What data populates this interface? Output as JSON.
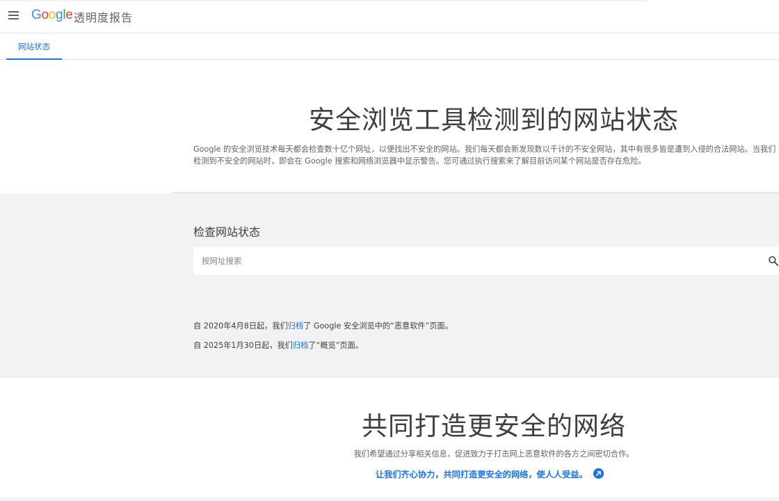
{
  "header": {
    "logo_letters": [
      {
        "char": "G",
        "color": "#4285F4"
      },
      {
        "char": "o",
        "color": "#EA4335"
      },
      {
        "char": "o",
        "color": "#FBBC05"
      },
      {
        "char": "g",
        "color": "#4285F4"
      },
      {
        "char": "l",
        "color": "#34A853"
      },
      {
        "char": "e",
        "color": "#EA4335"
      }
    ],
    "product_name": "透明度报告",
    "menu_icon": "hamburger-menu-icon"
  },
  "tabs": [
    {
      "label": "网站状态",
      "active": true
    }
  ],
  "hero": {
    "title": "安全浏览工具检测到的网站状态",
    "description": "Google 的安全浏览技术每天都会检查数十亿个网址，以便找出不安全的网站。我们每天都会新发现数以千计的不安全网站，其中有很多皆是遭到入侵的合法网站。当我们检测到不安全的网站时，即会在 Google 搜索和网络浏览器中显示警告。您可通过执行搜索来了解目前访问某个网站是否存在危险。"
  },
  "status_check": {
    "heading": "检查网站状态",
    "search_placeholder": "按网址搜索",
    "search_value": "",
    "search_icon": "search-icon"
  },
  "notices": [
    {
      "prefix": "自 2020年4月8日起，我们",
      "link_text": "归档",
      "suffix": "了 Google 安全浏览中的“恶意软件”页面。"
    },
    {
      "prefix": "自 2025年1月30日起，我们",
      "link_text": "归档",
      "suffix": "了“概览”页面。"
    }
  ],
  "bottom": {
    "title": "共同打造更安全的网络",
    "description": "我们希望通过分享相关信息，促进致力于打击网上恶意软件的各方之间密切合作。",
    "link_text": "让我们齐心协力，共同打造更安全的网络，使人人受益。",
    "link_icon": "arrow-up-right-circle-icon"
  },
  "colors": {
    "accent": "#1a73e8",
    "section_grey": "#f2f2f2",
    "text_primary": "#3c4043",
    "text_secondary": "#5f6368"
  }
}
